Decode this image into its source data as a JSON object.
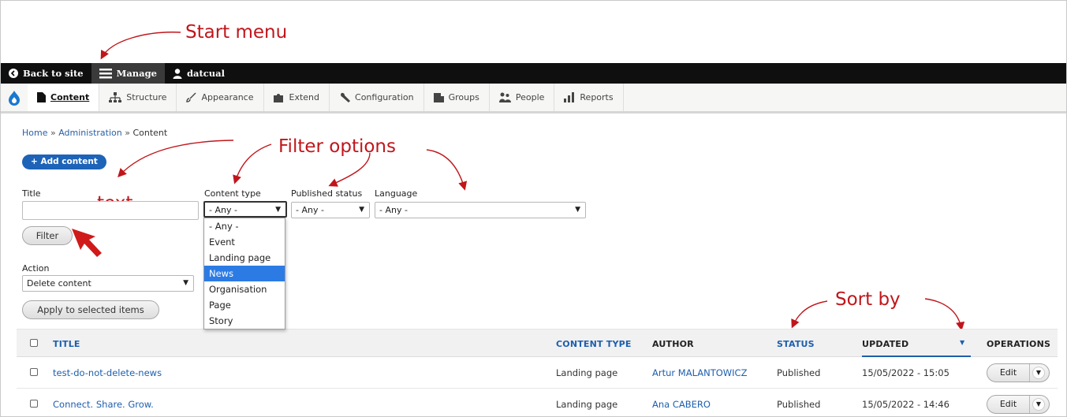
{
  "annotations": {
    "start_menu": "Start menu",
    "filter_options": "Filter options",
    "text": "text",
    "sort_by": "Sort by"
  },
  "toolbar": {
    "back_to_site": "Back to site",
    "manage": "Manage",
    "user": "datcual"
  },
  "tray": {
    "items": [
      "Content",
      "Structure",
      "Appearance",
      "Extend",
      "Configuration",
      "Groups",
      "People",
      "Reports"
    ]
  },
  "breadcrumb": [
    "Home",
    "Administration",
    "Content"
  ],
  "breadcrumb_separator": "»",
  "add_content": "+ Add content",
  "filters": {
    "title_label": "Title",
    "title_value": "",
    "content_type_label": "Content type",
    "content_type_value": "- Any -",
    "published_label": "Published status",
    "published_value": "- Any -",
    "language_label": "Language",
    "language_value": "- Any -",
    "filter_button": "Filter"
  },
  "content_type_options": [
    "- Any -",
    "Event",
    "Landing page",
    "News",
    "Organisation",
    "Page",
    "Story"
  ],
  "content_type_highlighted": "News",
  "action": {
    "label": "Action",
    "value": "Delete content",
    "apply_button": "Apply to selected items"
  },
  "table": {
    "headers": {
      "title": "TITLE",
      "content_type": "CONTENT TYPE",
      "author": "AUTHOR",
      "status": "STATUS",
      "updated": "UPDATED",
      "operations": "OPERATIONS"
    },
    "rows": [
      {
        "title": "test-do-not-delete-news",
        "content_type": "Landing page",
        "author": "Artur MALANTOWICZ",
        "status": "Published",
        "updated": "15/05/2022 - 15:05",
        "op": "Edit"
      },
      {
        "title": "Connect. Share. Grow.",
        "content_type": "Landing page",
        "author": "Ana CABERO",
        "status": "Published",
        "updated": "15/05/2022 - 14:46",
        "op": "Edit"
      }
    ]
  },
  "colors": {
    "annotation": "#c0161b",
    "toolbar": "#0f0f0f",
    "link": "#1d5fae",
    "primary_button": "#1d63b8",
    "dropdown_highlight": "#2c7be5"
  }
}
